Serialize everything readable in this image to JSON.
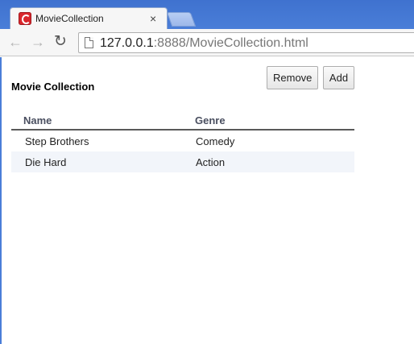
{
  "browser": {
    "tab_title": "MovieCollection",
    "tab_close": "×",
    "url_host": "127.0.0.1",
    "url_rest": ":8888/MovieCollection.html",
    "back_icon": "←",
    "forward_icon": "→",
    "reload_icon": "↻"
  },
  "page": {
    "title": "Movie Collection",
    "buttons": {
      "remove": "Remove",
      "add": "Add"
    },
    "grid": {
      "columns": [
        "Name",
        "Genre"
      ],
      "rows": [
        {
          "name": "Step Brothers",
          "genre": "Comedy"
        },
        {
          "name": "Die Hard",
          "genre": "Action"
        }
      ]
    }
  },
  "colors": {
    "chrome_blue": "#4a7ed8",
    "alt_row": "#f2f5fa",
    "header_text": "#4a4f60"
  }
}
